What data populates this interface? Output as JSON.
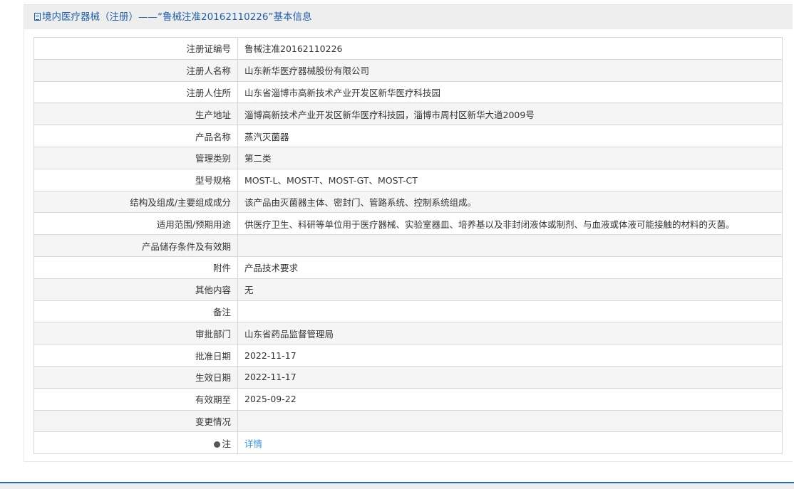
{
  "header": {
    "title": "境内医疗器械（注册）——“鲁械注准20162110226”基本信息",
    "icon": "document-icon"
  },
  "rows": [
    {
      "label": "注册证编号",
      "value": "鲁械注准20162110226"
    },
    {
      "label": "注册人名称",
      "value": "山东新华医疗器械股份有限公司"
    },
    {
      "label": "注册人住所",
      "value": "山东省淄博市高新技术产业开发区新华医疗科技园"
    },
    {
      "label": "生产地址",
      "value": "淄博高新技术产业开发区新华医疗科技园，淄博市周村区新华大道2009号"
    },
    {
      "label": "产品名称",
      "value": "蒸汽灭菌器"
    },
    {
      "label": "管理类别",
      "value": "第二类"
    },
    {
      "label": "型号规格",
      "value": "MOST-L、MOST-T、MOST-GT、MOST-CT"
    },
    {
      "label": "结构及组成/主要组成成分",
      "value": "该产品由灭菌器主体、密封门、管路系统、控制系统组成。"
    },
    {
      "label": "适用范围/预期用途",
      "value": "供医疗卫生、科研等单位用于医疗器械、实验室器皿、培养基以及非封闭液体或制剂、与血液或体液可能接触的材料的灭菌。"
    },
    {
      "label": "产品储存条件及有效期",
      "value": ""
    },
    {
      "label": "附件",
      "value": "产品技术要求"
    },
    {
      "label": "其他内容",
      "value": "无"
    },
    {
      "label": "备注",
      "value": ""
    },
    {
      "label": "审批部门",
      "value": "山东省药品监督管理局"
    },
    {
      "label": "批准日期",
      "value": "2022-11-17"
    },
    {
      "label": "生效日期",
      "value": "2022-11-17"
    },
    {
      "label": "有效期至",
      "value": "2025-09-22"
    },
    {
      "label": "变更情况",
      "value": ""
    }
  ],
  "note": {
    "label": "注",
    "link": "详情",
    "icon": "lightbulb-icon"
  }
}
